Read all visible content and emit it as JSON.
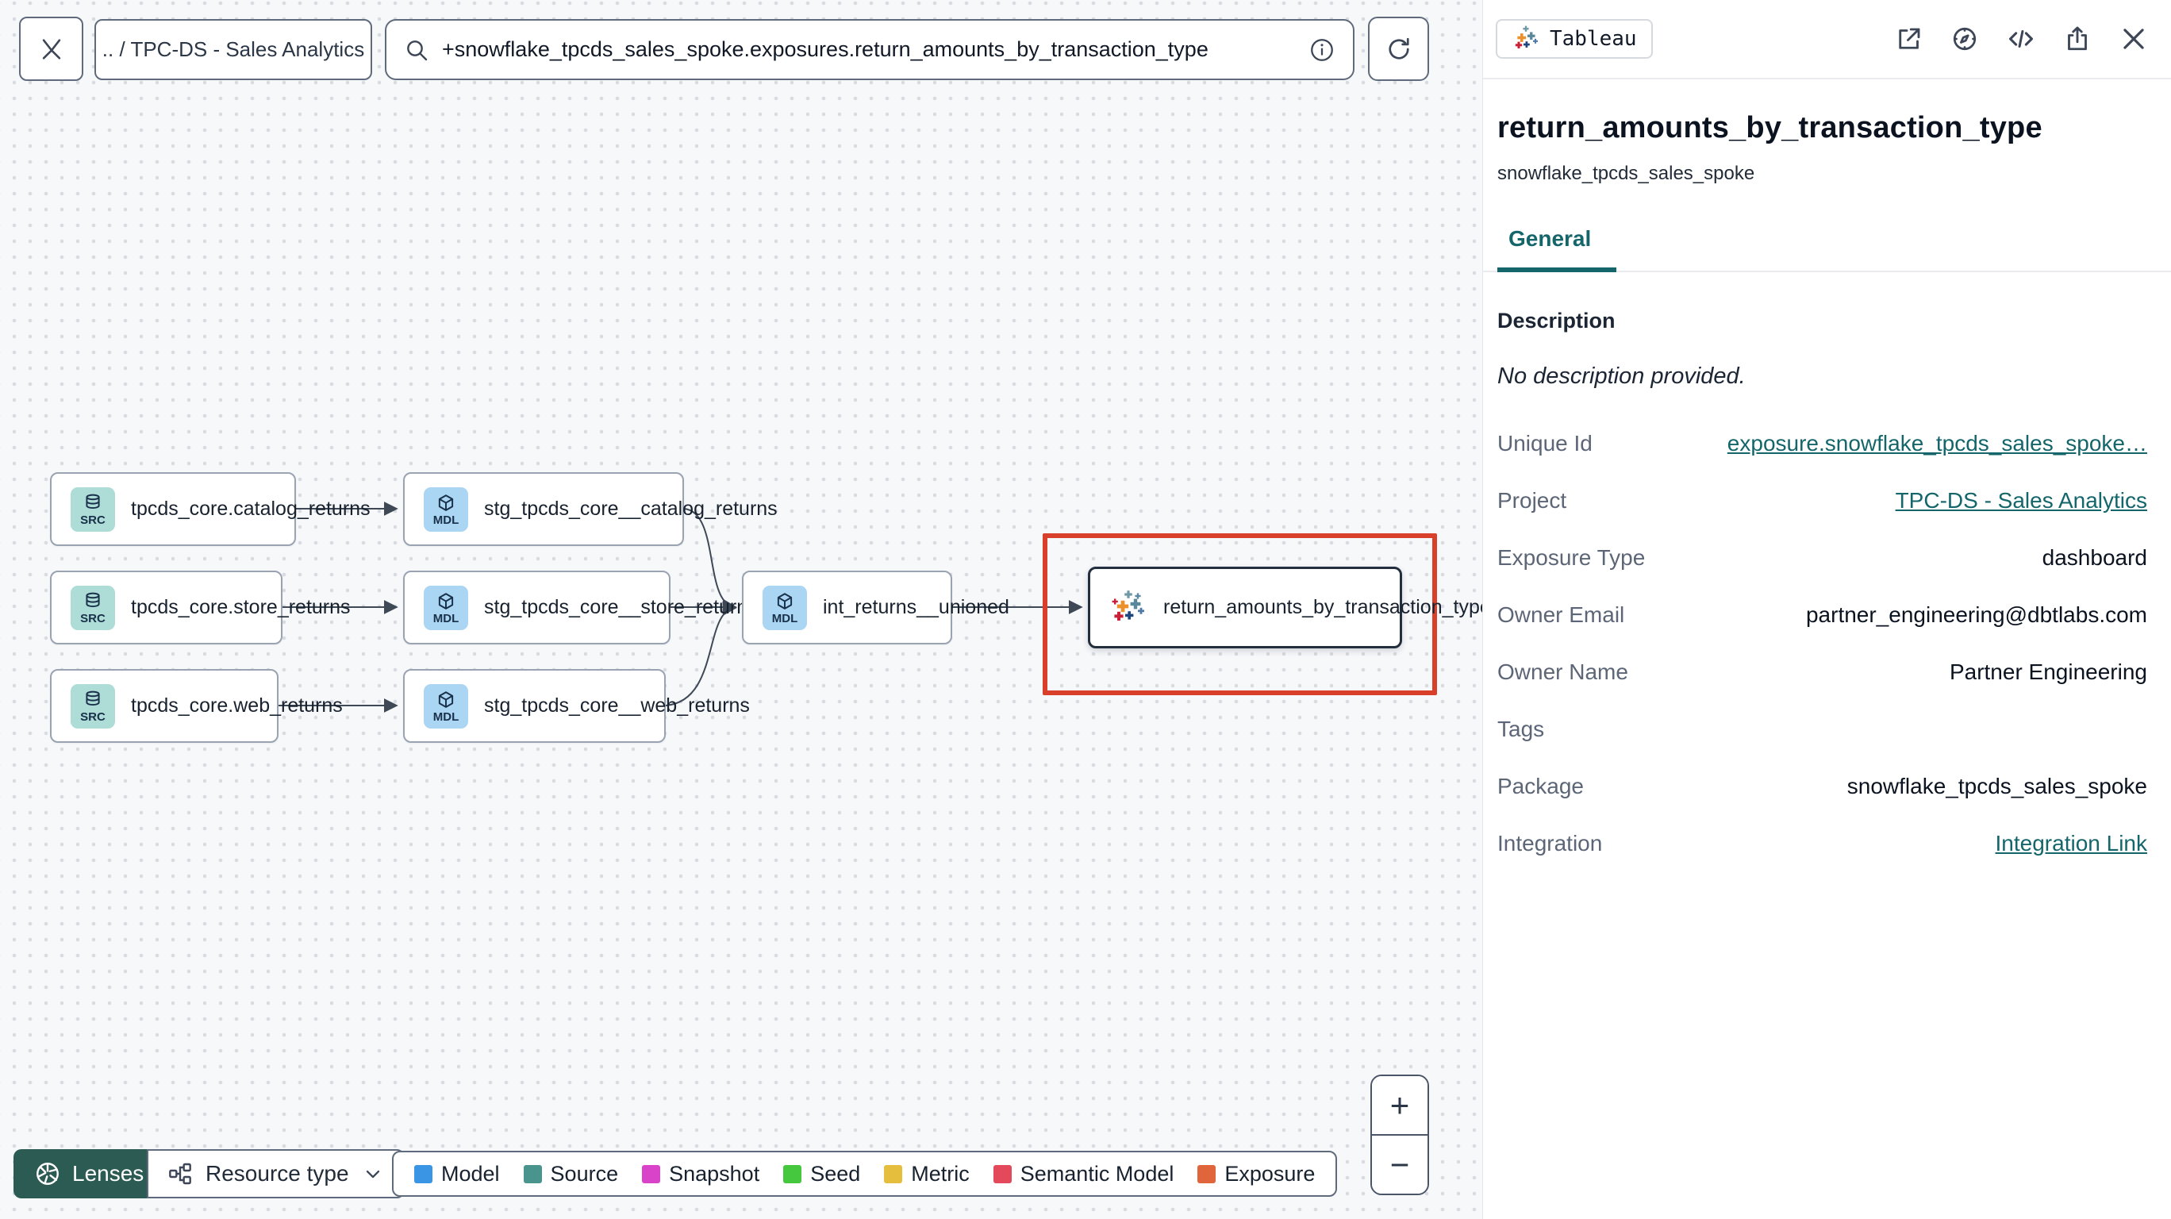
{
  "colors": {
    "accent_teal": "#14666b",
    "highlight_red": "#d8402c",
    "lenses_green": "#2b5b53"
  },
  "toolbar": {
    "breadcrumb": ".. / TPC-DS - Sales Analytics",
    "search_value": "+snowflake_tpcds_sales_spoke.exposures.return_amounts_by_transaction_type"
  },
  "graph": {
    "nodes": [
      {
        "label": "tpcds_core.catalog_returns",
        "badge": "SRC",
        "type": "source"
      },
      {
        "label": "tpcds_core.store_returns",
        "badge": "SRC",
        "type": "source"
      },
      {
        "label": "tpcds_core.web_returns",
        "badge": "SRC",
        "type": "source"
      },
      {
        "label": "stg_tpcds_core__catalog_returns",
        "badge": "MDL",
        "type": "model"
      },
      {
        "label": "stg_tpcds_core__store_returns",
        "badge": "MDL",
        "type": "model"
      },
      {
        "label": "stg_tpcds_core__web_returns",
        "badge": "MDL",
        "type": "model"
      },
      {
        "label": "int_returns__unioned",
        "badge": "MDL",
        "type": "model"
      },
      {
        "label": "return_amounts_by_transaction_type",
        "type": "exposure"
      }
    ]
  },
  "controls": {
    "lenses_label": "Lenses",
    "resource_type_label": "Resource type",
    "zoom_in": "+",
    "zoom_out": "−"
  },
  "legend": {
    "items": [
      {
        "label": "Model",
        "color": "#3b95e5"
      },
      {
        "label": "Source",
        "color": "#4a948e"
      },
      {
        "label": "Snapshot",
        "color": "#d943c9"
      },
      {
        "label": "Seed",
        "color": "#45c83d"
      },
      {
        "label": "Metric",
        "color": "#e5be3d"
      },
      {
        "label": "Semantic Model",
        "color": "#e4485b"
      },
      {
        "label": "Exposure",
        "color": "#e0653a"
      }
    ]
  },
  "panel": {
    "integration_badge": "Tableau",
    "title": "return_amounts_by_transaction_type",
    "subtitle": "snowflake_tpcds_sales_spoke",
    "tab_general": "General",
    "description_label": "Description",
    "description_value": "No description provided.",
    "fields": [
      {
        "label": "Unique Id",
        "value": "exposure.snowflake_tpcds_sales_spoke…",
        "link": true
      },
      {
        "label": "Project",
        "value": "TPC-DS - Sales Analytics",
        "link": true
      },
      {
        "label": "Exposure Type",
        "value": "dashboard",
        "link": false
      },
      {
        "label": "Owner Email",
        "value": "partner_engineering@dbtlabs.com",
        "link": false
      },
      {
        "label": "Owner Name",
        "value": "Partner Engineering",
        "link": false
      },
      {
        "label": "Tags",
        "value": "",
        "link": false
      },
      {
        "label": "Package",
        "value": "snowflake_tpcds_sales_spoke",
        "link": false
      },
      {
        "label": "Integration",
        "value": "Integration Link",
        "link": true
      }
    ]
  }
}
